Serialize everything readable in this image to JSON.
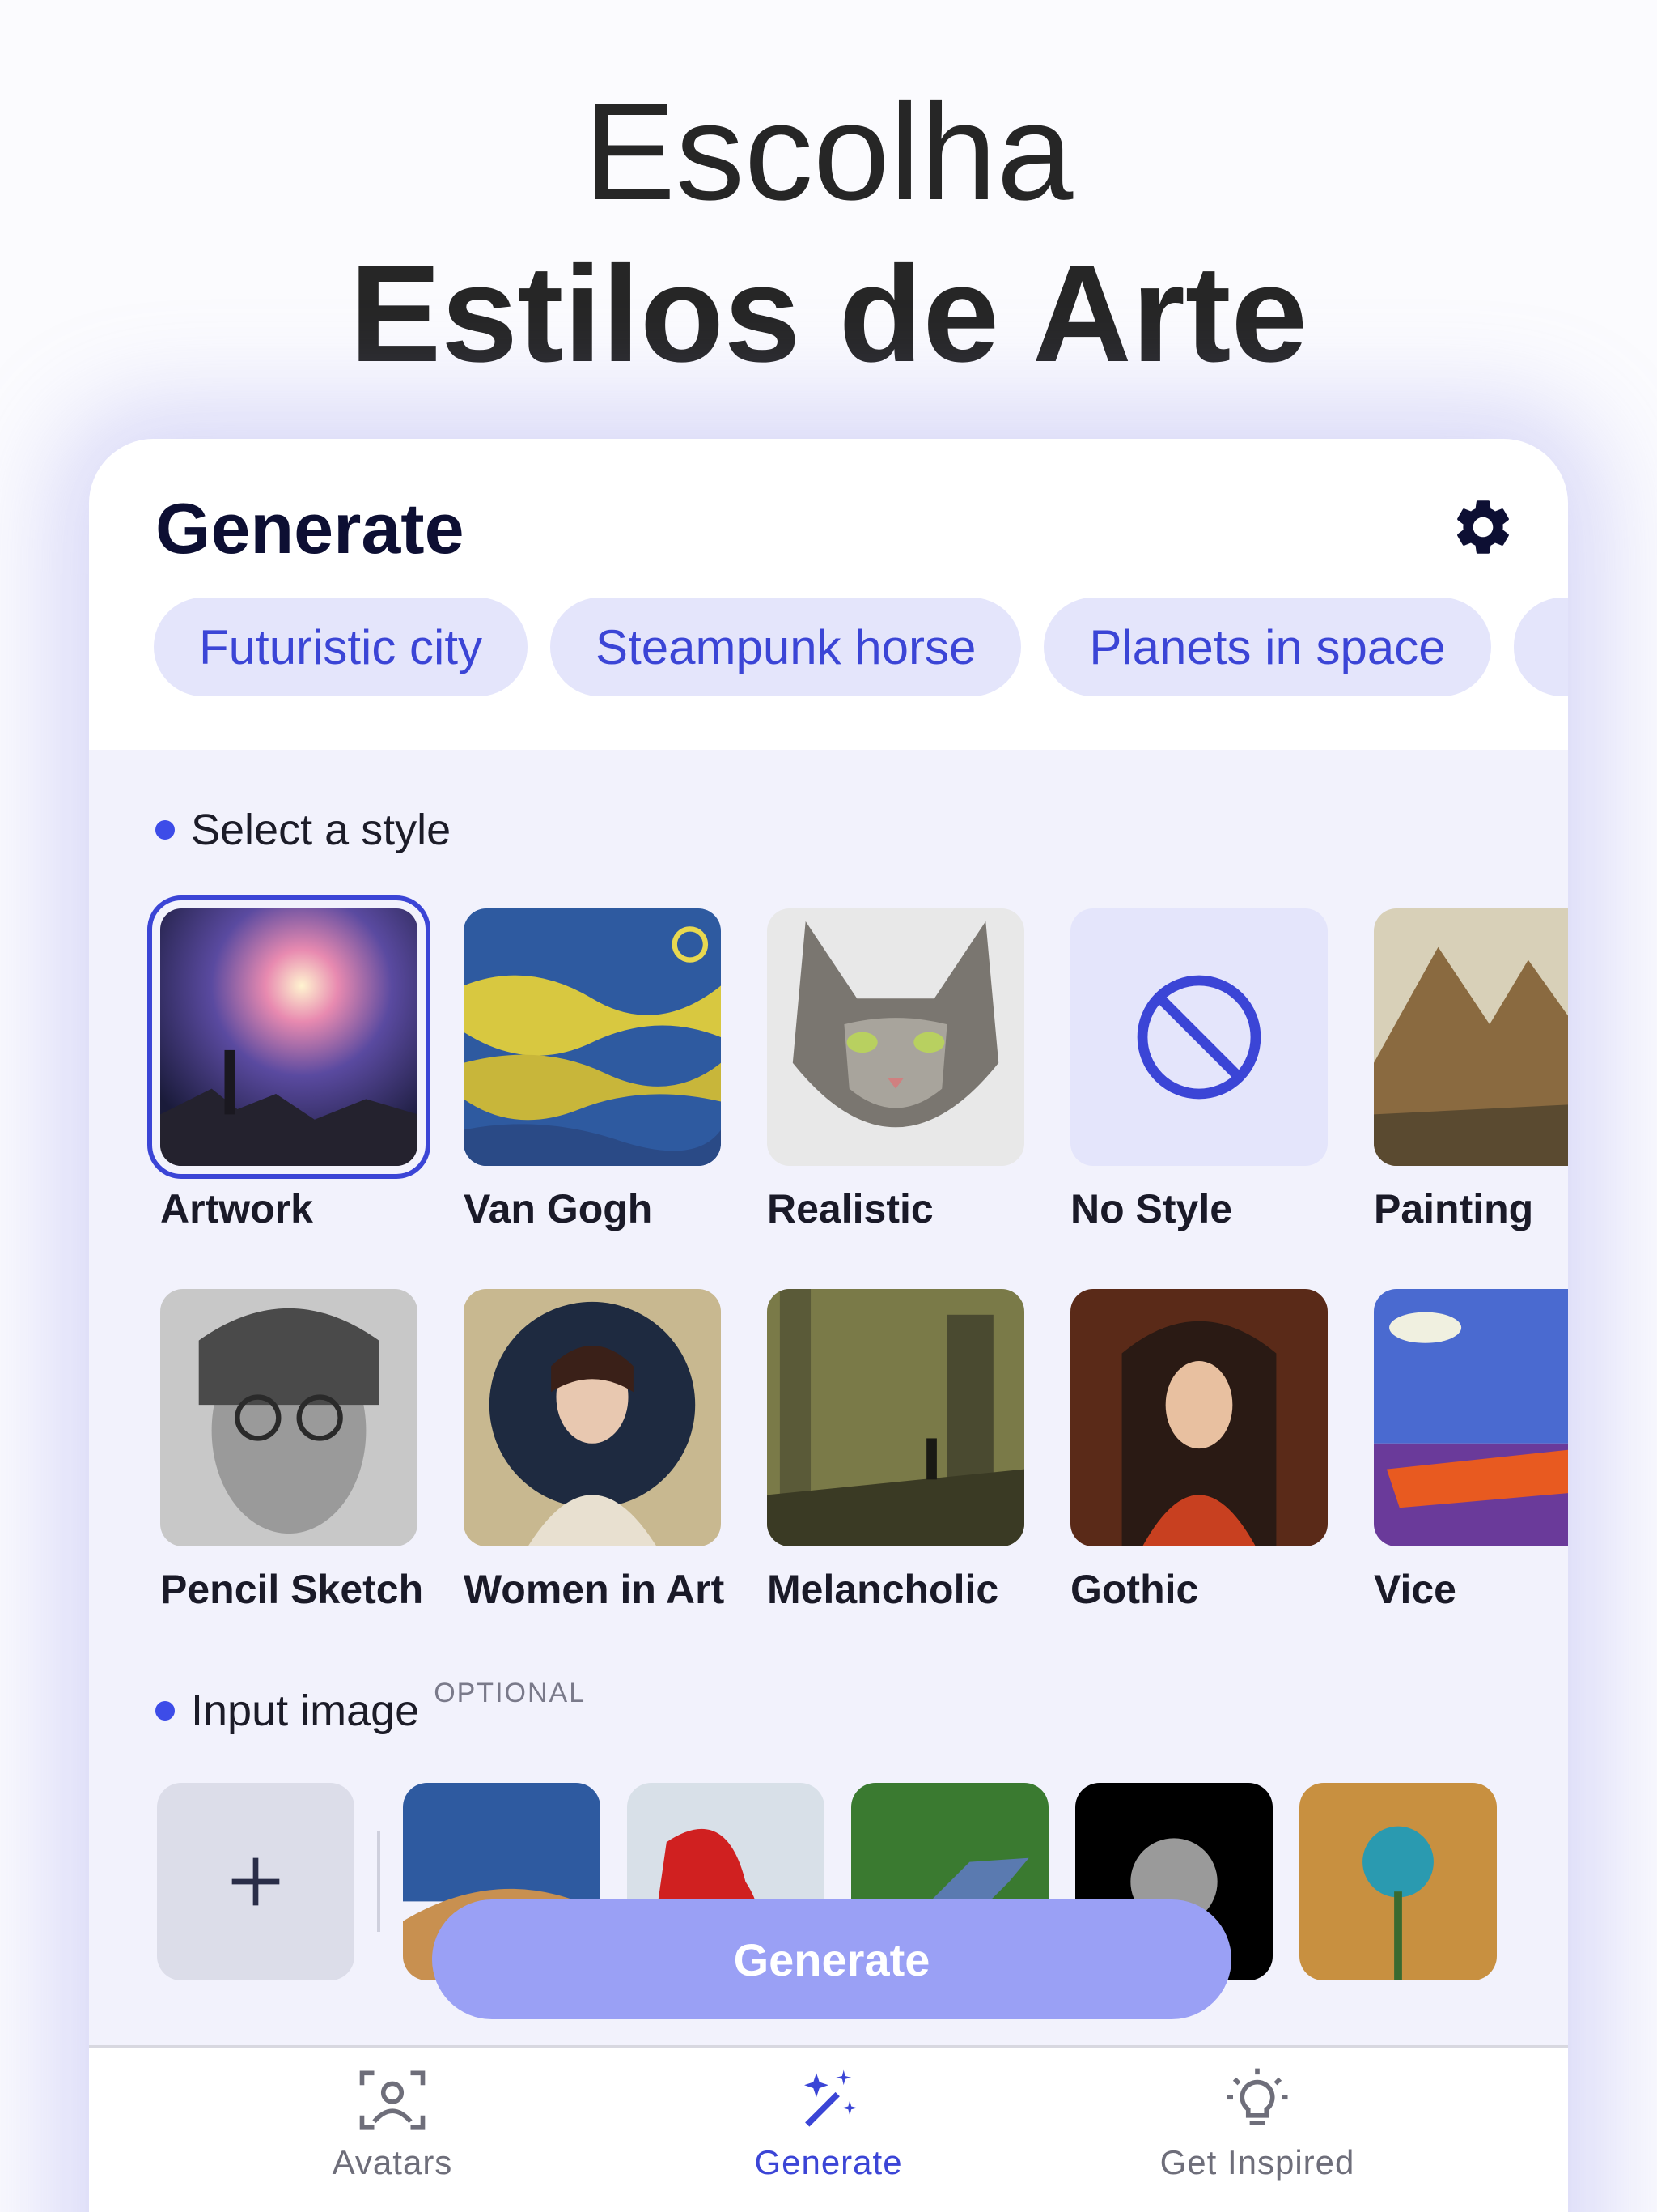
{
  "headline": {
    "line1": "Escolha",
    "line2": "Estilos de Arte"
  },
  "header": {
    "title": "Generate",
    "settings_icon": "gear-icon"
  },
  "prompt_chips": [
    "Futuristic city",
    "Steampunk horse",
    "Planets in space"
  ],
  "styles_section": {
    "label": "Select a style",
    "selected": "Artwork",
    "styles": [
      {
        "label": "Artwork"
      },
      {
        "label": "Van Gogh"
      },
      {
        "label": "Realistic"
      },
      {
        "label": "No Style"
      },
      {
        "label": "Painting"
      },
      {
        "label": "Pencil Sketch"
      },
      {
        "label": "Women in Art"
      },
      {
        "label": "Melancholic"
      },
      {
        "label": "Gothic"
      },
      {
        "label": "Vice"
      }
    ]
  },
  "input_section": {
    "label": "Input image",
    "badge": "OPTIONAL",
    "add_icon": "plus-icon"
  },
  "generate_button": {
    "label": "Generate"
  },
  "bottom_nav": {
    "active": "Generate",
    "items": [
      {
        "label": "Avatars",
        "icon": "avatar-scan-icon"
      },
      {
        "label": "Generate",
        "icon": "magic-wand-icon"
      },
      {
        "label": "Get Inspired",
        "icon": "lightbulb-icon"
      }
    ]
  },
  "colors": {
    "accent": "#3b45d6",
    "chip_bg": "#e4e5fb",
    "button_bg": "#9aa0f5",
    "panel_bg": "#f2f2fc"
  }
}
